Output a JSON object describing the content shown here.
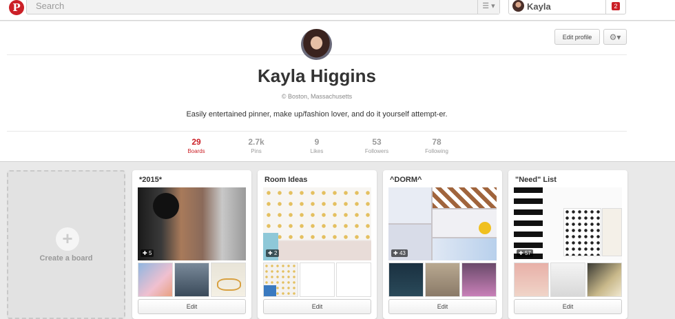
{
  "header": {
    "logo": "P",
    "search_placeholder": "Search",
    "username": "Kayla",
    "notification_count": "2"
  },
  "profile": {
    "name": "Kayla Higgins",
    "location": "© Boston, Massachusetts",
    "bio": "Easily entertained pinner, make up/fashion lover, and do it yourself attempt-er.",
    "edit_profile_label": "Edit profile",
    "stats": [
      {
        "value": "29",
        "label": "Boards"
      },
      {
        "value": "2.7k",
        "label": "Pins"
      },
      {
        "value": "9",
        "label": "Likes"
      },
      {
        "value": "53",
        "label": "Followers"
      },
      {
        "value": "78",
        "label": "Following"
      }
    ]
  },
  "create_board": {
    "label": "Create a board"
  },
  "boards": [
    {
      "title": "*2015*",
      "pin_count": "5",
      "edit_label": "Edit"
    },
    {
      "title": "Room Ideas",
      "pin_count": "2",
      "edit_label": "Edit"
    },
    {
      "title": "^DORM^",
      "pin_count": "43",
      "edit_label": "Edit"
    },
    {
      "title": "\"Need\" List",
      "pin_count": "57",
      "edit_label": "Edit"
    }
  ],
  "colors": {
    "brand_red": "#cb2027",
    "page_bg": "#e9e9e9"
  },
  "icons": [
    "pinterest-logo",
    "list-menu-icon",
    "gear-icon",
    "pin-icon",
    "plus-icon"
  ]
}
